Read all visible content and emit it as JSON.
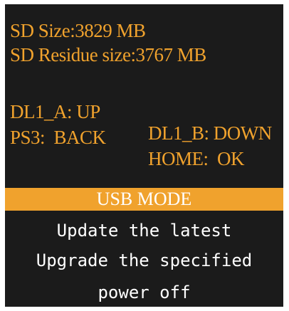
{
  "colors": {
    "accent": "#f0a22d",
    "background": "#1b1b1b",
    "menu_text": "#ffffff"
  },
  "info": {
    "sd_size": "SD Size:3829 MB",
    "sd_residue": "SD Residue size:3767 MB",
    "dl1_a": "DL1_A: UP",
    "dl1_b": "DL1_B: DOWN",
    "ps3": "PS3:  BACK",
    "home": "HOME:  OK"
  },
  "menu": {
    "items": [
      {
        "label": "USB MODE",
        "selected": true
      },
      {
        "label": "Update the latest",
        "selected": false
      },
      {
        "label": "Upgrade the specified",
        "selected": false
      },
      {
        "label": "power off",
        "selected": false
      }
    ]
  }
}
